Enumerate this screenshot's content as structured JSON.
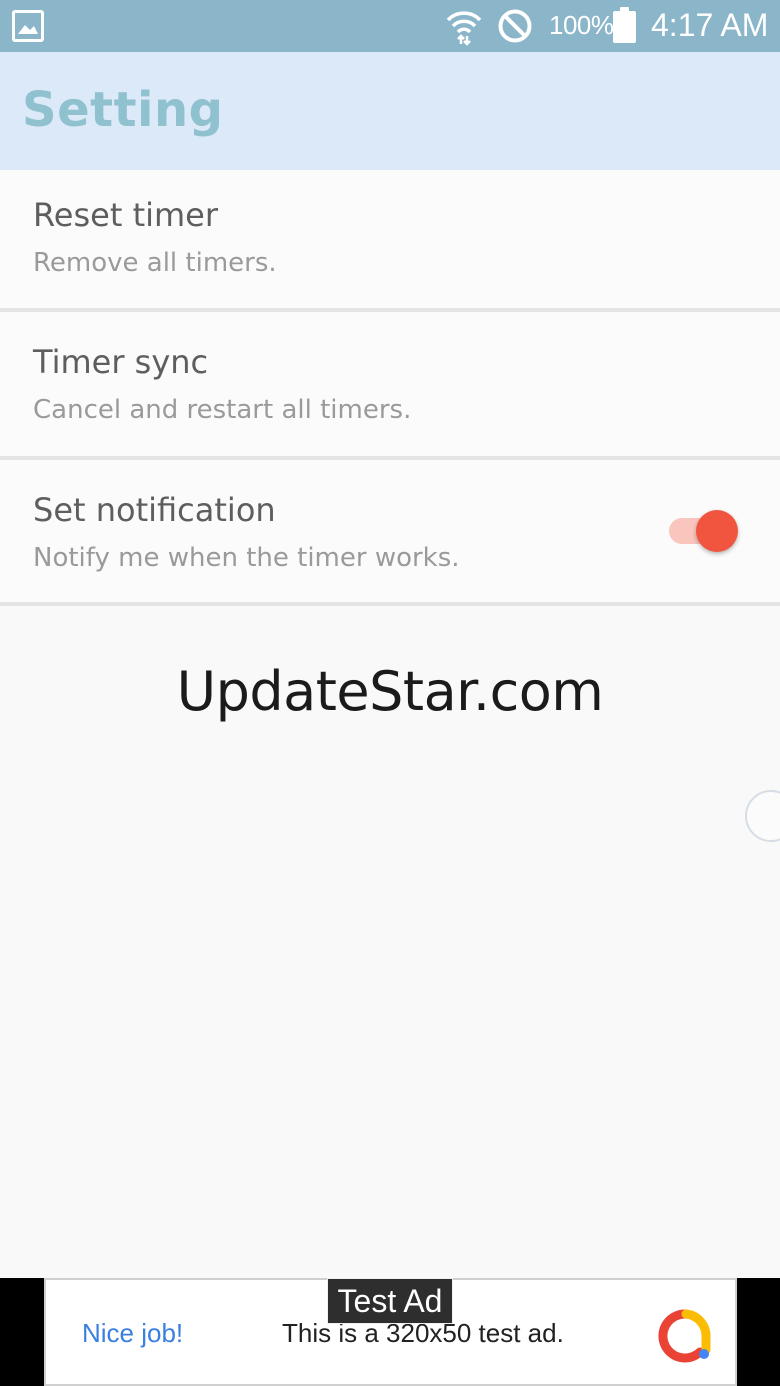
{
  "status_bar": {
    "battery_text": "100%",
    "time": "4:17 AM",
    "icons": [
      "gallery-icon",
      "wifi-icon",
      "block-icon",
      "battery-icon"
    ]
  },
  "app_bar": {
    "title": "Setting"
  },
  "settings": [
    {
      "title": "Reset timer",
      "subtitle": "Remove all timers."
    },
    {
      "title": "Timer sync",
      "subtitle": "Cancel and restart all timers."
    },
    {
      "title": "Set notification",
      "subtitle": "Notify me when the timer works.",
      "toggle_on": true
    }
  ],
  "watermark": "UpdateStar.com",
  "ad": {
    "label": "Test Ad",
    "nice_job": "Nice job!",
    "text": "This is a 320x50 test ad."
  },
  "colors": {
    "status_bar": "#8bb5c9",
    "app_bar": "#dbe9f8",
    "title": "#8fc1cf",
    "toggle_thumb": "#f2553f",
    "toggle_track": "#f9c5bd",
    "ad_link": "#3b7fe0"
  }
}
